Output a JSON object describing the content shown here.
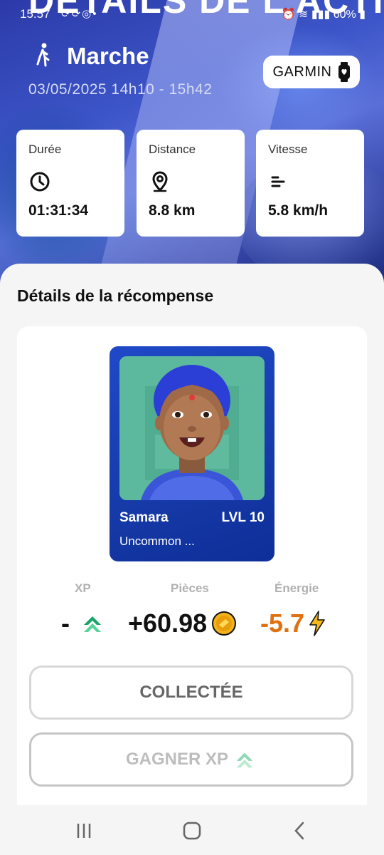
{
  "status_bar": {
    "time": "15:57",
    "notification_icons": [
      "sync-icon",
      "sync-icon",
      "messenger-icon",
      "dot-icon"
    ],
    "right_icons": [
      "alarm-icon",
      "wifi-icon",
      "volte-icon",
      "signal-icon"
    ],
    "battery": "60%"
  },
  "header": {
    "ghost_title": "DÉTAILS DE L'ACTIVITÉ"
  },
  "activity": {
    "icon": "walking-person-icon",
    "title": "Marche",
    "time_range": "03/05/2025 14h10 - 15h42",
    "device_label": "GARMIN",
    "device_icon": "smartwatch-icon"
  },
  "stats": [
    {
      "label": "Durée",
      "icon": "clock-icon",
      "value": "01:31:34"
    },
    {
      "label": "Distance",
      "icon": "location-pin-icon",
      "value": "8.8 km"
    },
    {
      "label": "Vitesse",
      "icon": "speed-lines-icon",
      "value": "5.8 km/h"
    }
  ],
  "reward": {
    "section_title": "Détails de la récompense",
    "card": {
      "name": "Samara",
      "level": "LVL 10",
      "rarity": "Uncommon ..."
    },
    "xp": {
      "label": "XP",
      "value": "-",
      "icon": "xp-arrows-icon",
      "color": "#1aa36b"
    },
    "coins": {
      "label": "Pièces",
      "value": "+60.98",
      "icon": "coin-icon",
      "color": "#111111"
    },
    "energy": {
      "label": "Énergie",
      "value": "-5.7",
      "icon": "lightning-icon",
      "color": "#e07010"
    },
    "collected_button": "COLLECTÉE",
    "earn_xp_button": "GAGNER XP"
  },
  "navigation": {
    "recents": "recents-icon",
    "home": "home-icon",
    "back": "back-icon"
  },
  "colors": {
    "card_blue": "#1f49c8",
    "sheet_bg": "#f5f5f5",
    "energy_orange": "#e07010",
    "xp_green": "#1aa36b"
  }
}
